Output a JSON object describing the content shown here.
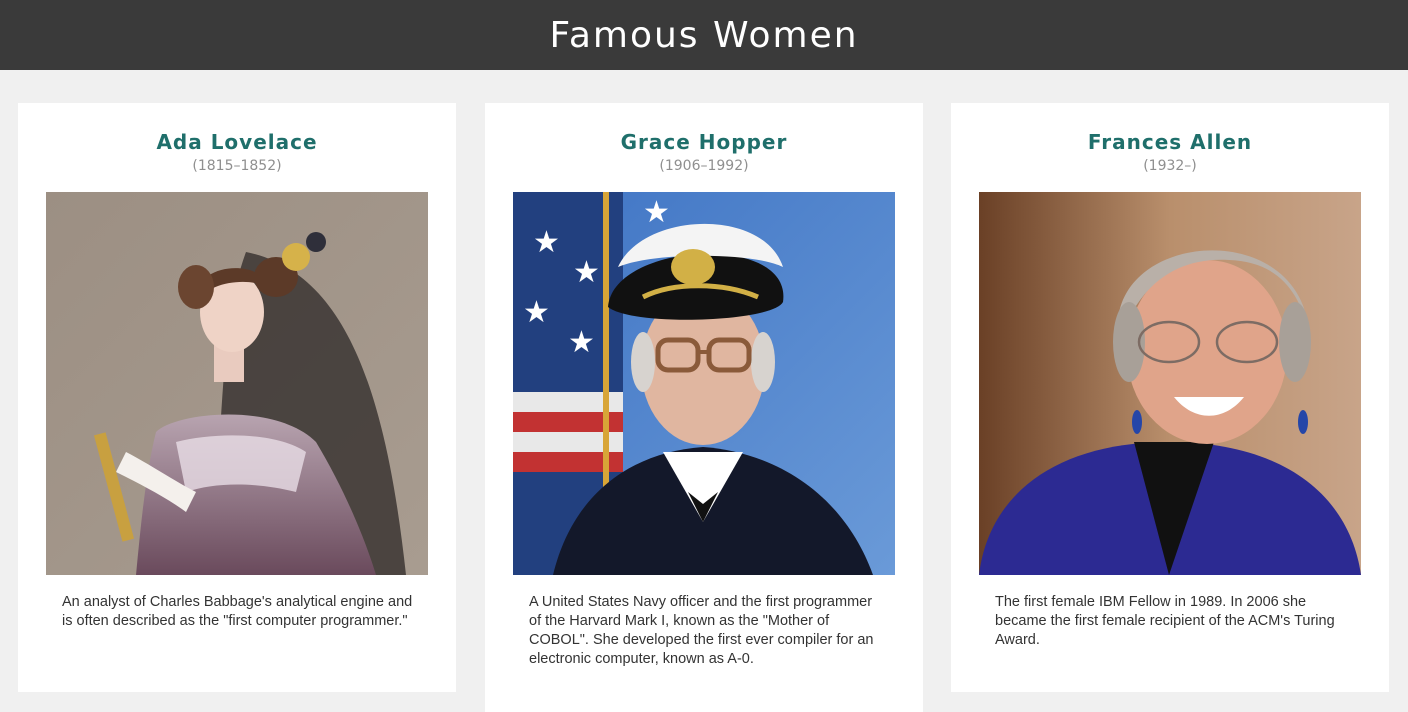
{
  "header": {
    "title": "Famous Women"
  },
  "cards": [
    {
      "name": "Ada Lovelace",
      "dates": "(1815–1852)",
      "description": "An analyst of Charles Babbage's analytical engine and is often described as the \"first computer programmer.\""
    },
    {
      "name": "Grace Hopper",
      "dates": "(1906–1992)",
      "description": "A United States Navy officer and the first programmer of the Harvard Mark I, known as the \"Mother of COBOL\". She developed the first ever compiler for an electronic computer, known as A-0."
    },
    {
      "name": "Frances Allen",
      "dates": "(1932–)",
      "description": "The first female IBM Fellow in 1989. In 2006 she became the first female recipient of the ACM's Turing Award."
    }
  ],
  "colors": {
    "header_bg": "#3a3a3a",
    "page_bg": "#f0f0f0",
    "name_accent": "#1f6f6b",
    "dates_text": "#8f8f8f"
  }
}
